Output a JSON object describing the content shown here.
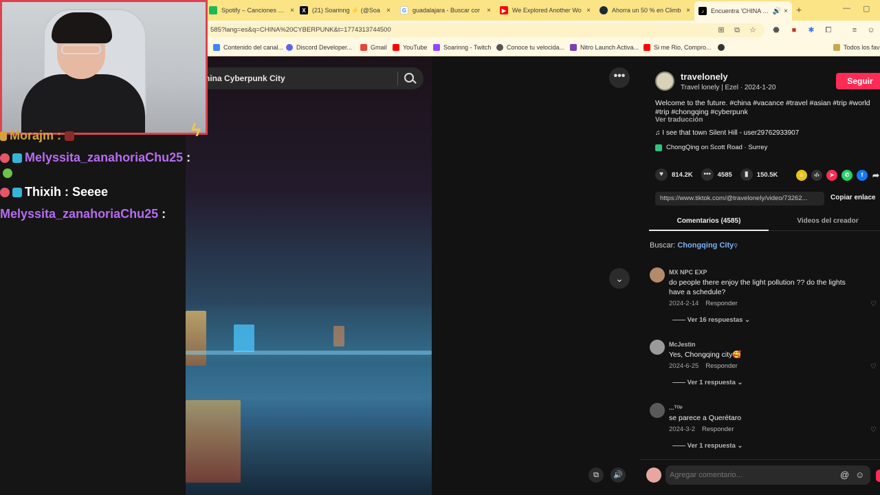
{
  "browser": {
    "tabs": [
      {
        "title": "Spotify – Canciones que s",
        "color": "#1db954"
      },
      {
        "title": "(21) Soarinng ⚡ (@Soa",
        "color": "#000000"
      },
      {
        "title": "guadalajara - Buscar cor",
        "color": "#4285f4"
      },
      {
        "title": "We Explored Another Wo",
        "color": "#ff0000"
      },
      {
        "title": "Ahorra un 50 % en Climb",
        "color": "#1b2838"
      },
      {
        "title": "Encuentra 'CHINA CY",
        "color": "#000000",
        "active": true
      }
    ],
    "url": "585?lang=es&q=CHINA%20CYBERPUNK&t=1774313744500",
    "bookmarks": [
      {
        "label": "Contenido del canal...",
        "color": "#4285f4"
      },
      {
        "label": "Discord Developer...",
        "color": "#5865f2"
      },
      {
        "label": "Gmail",
        "color": "#ea4335"
      },
      {
        "label": "YouTube",
        "color": "#ff0000"
      },
      {
        "label": "Soarinng - Twitch",
        "color": "#9146ff"
      },
      {
        "label": "Conoce tu velocida...",
        "color": "#555555"
      },
      {
        "label": "Nitro Launch Activa...",
        "color": "#7a3fb0"
      },
      {
        "label": "Si me Rio, Compro...",
        "color": "#ff0000"
      }
    ],
    "all_bookmarks": "Todos los fav"
  },
  "stream_chat": [
    {
      "user": "Morajm",
      "message": "",
      "user_color": "orange"
    },
    {
      "user": "Melyssita_zanahoriaChu25",
      "message": ":",
      "user_color": "purple"
    },
    {
      "user": "Thixih",
      "message": ": Seeee",
      "user_color": "white"
    },
    {
      "user": "Melyssita_zanahoriaChu25",
      "message": ":",
      "user_color": "purple"
    }
  ],
  "video": {
    "search_query": "hina Cyberpunk City"
  },
  "author": {
    "username": "travelonely",
    "subline": "Travel lonely | Ezel · 2024-1-20",
    "follow_label": "Seguir",
    "description": "Welcome to the future. #china #vacance #travel #asian #trip #world #trip #chongqing #cyberpunk",
    "translate_label": "Ver traducción",
    "music": "♫  I see that town Silent Hill - user29762933907",
    "location": "ChongQing on Scott Road · Surrey"
  },
  "stats": {
    "likes": "814.2K",
    "comments": "4585",
    "saves": "150.5K"
  },
  "share": {
    "link": "https://www.tiktok.com/@travelonely/video/73262...",
    "copy_label": "Copiar enlace"
  },
  "tabs": {
    "comments_label": "Comentarios (4585)",
    "creator_label": "Videos del creador"
  },
  "related_search": {
    "prefix": "Buscar:",
    "query": "Chongqing City"
  },
  "comments": [
    {
      "user": "MX NPC EXP",
      "text": "do people there enjoy the light pollution ?? do the lights have a schedule?",
      "date": "2024-2-14",
      "reply": "Responder",
      "replies": "Ver 16 respuestas ⌄"
    },
    {
      "user": "McJestin",
      "text": "Yes, Chongqing city🥰",
      "date": "2024-6-25",
      "reply": "Responder",
      "replies": "Ver 1 respuesta ⌄"
    },
    {
      "user": "...ᵀᴼᵖ",
      "text": "se parece a Querétaro",
      "date": "2024-3-2",
      "reply": "Responder",
      "replies": "Ver 1 respuesta ⌄"
    }
  ],
  "comment_box": {
    "placeholder": "Agregar comentario..."
  }
}
